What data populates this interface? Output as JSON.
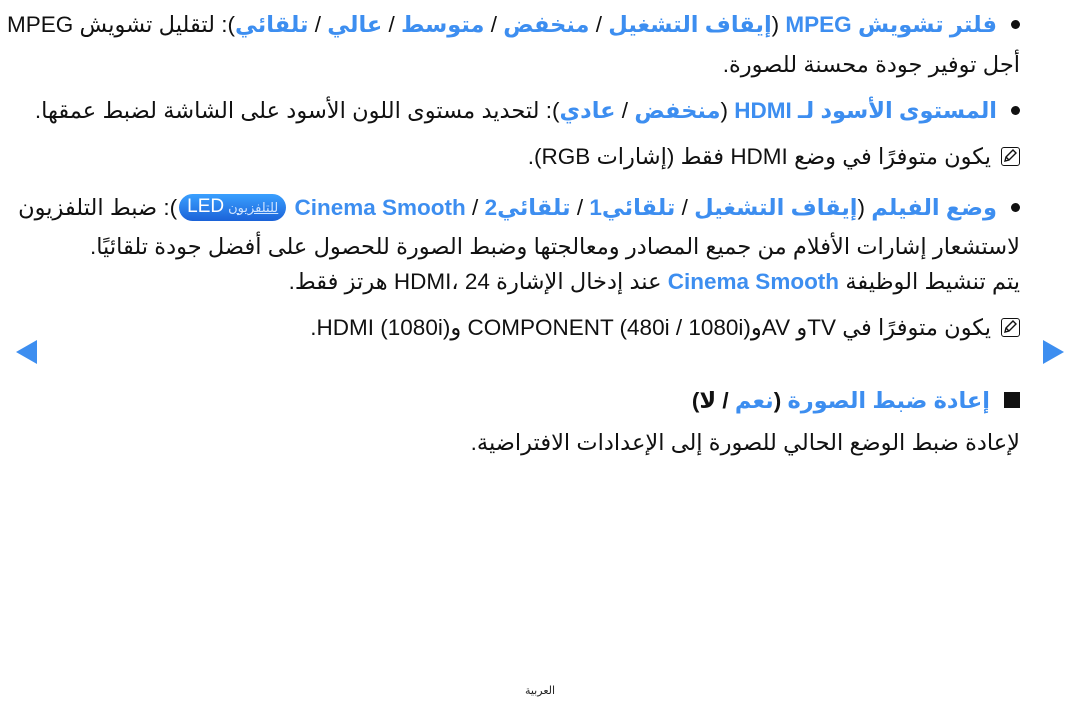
{
  "colors": {
    "accent": "#3d8ef0",
    "text": "#111111"
  },
  "items": {
    "mpeg": {
      "title": "فلتر تشويش MPEG",
      "options": [
        "إيقاف التشغيل",
        "منخفض",
        "متوسط",
        "عالي",
        "تلقائي"
      ],
      "separator": " / ",
      "desc_line1": ": لتقليل تشويش MPEG من",
      "desc_line2": "أجل توفير جودة محسنة للصورة."
    },
    "hdmi_black": {
      "title": "المستوى الأسود لـ HDMI",
      "options": [
        "منخفض",
        "عادي"
      ],
      "desc": ": لتحديد مستوى اللون الأسود على الشاشة لضبط عمقها.",
      "note": "يكون متوفرًا في وضع HDMI فقط (إشارات RGB)."
    },
    "film_mode": {
      "title": "وضع الفيلم",
      "options": [
        "إيقاف التشغيل",
        "تلقائي1",
        "تلقائي2",
        "Cinema Smooth"
      ],
      "badge_small": "للتلفزيون",
      "badge_main": "LED",
      "desc_line1": ": ضبط التلفزيون",
      "desc_line2": "لاستشعار إشارات الأفلام من جميع المصادر ومعالجتها وضبط الصورة للحصول على أفضل جودة تلقائيًا.",
      "desc_line3_a": "يتم تنشيط الوظيفة",
      "desc_line3_b": "Cinema Smooth",
      "desc_line3_c": "عند إدخال الإشارة HDMI، 24 هرتز فقط.",
      "note": "يكون متوفرًا في  TVو AVوCOMPONENT (480i / 1080i) وHDMI (1080i)."
    },
    "picture_reset": {
      "title": "إعادة ضبط الصورة",
      "options": [
        "نعم",
        "لا"
      ],
      "desc": "لإعادة ضبط الوضع الحالي للصورة إلى الإعدادات الافتراضية."
    }
  },
  "punct": {
    "open": " (",
    "close": ")"
  },
  "icons": {
    "bullet": "bullet-icon",
    "note": "note-icon",
    "square": "square-bullet-icon",
    "prev": "prev-page-arrow",
    "next": "next-page-arrow"
  },
  "footer": {
    "language": "العربية"
  }
}
